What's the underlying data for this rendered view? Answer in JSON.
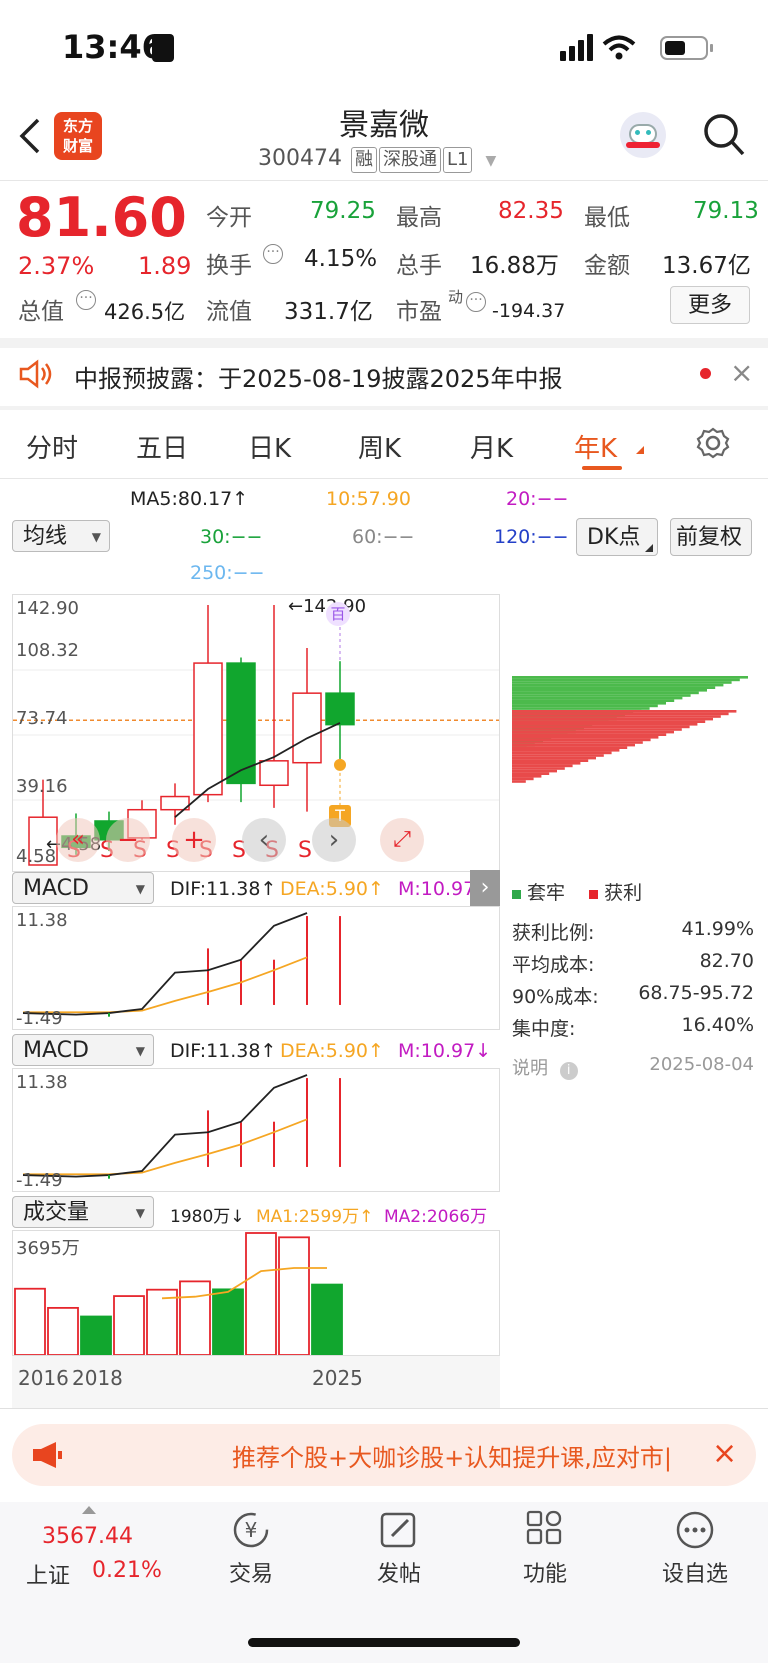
{
  "status": {
    "time": "13:46"
  },
  "header": {
    "back_icon": "chevron-left-icon",
    "logo_text_1": "东方",
    "logo_text_2": "财富",
    "title": "景嘉微",
    "code": "300474",
    "badges": [
      "融",
      "深股通",
      "L1"
    ],
    "avatar_icon": "robot-avatar-icon",
    "search_icon": "search-icon"
  },
  "quote": {
    "price": "81.60",
    "change_pct": "2.37%",
    "change_amt": "1.89",
    "open_label": "今开",
    "open": "79.25",
    "high_label": "最高",
    "high": "82.35",
    "low_label": "最低",
    "low": "79.13",
    "turnover_label": "换手",
    "turnover": "4.15%",
    "volume_label": "总手",
    "volume": "16.88万",
    "amount_label": "金额",
    "amount": "13.67亿",
    "total_mv_label": "总值",
    "total_mv": "426.5亿",
    "float_mv_label": "流值",
    "float_mv": "331.7亿",
    "pe_label": "市盈",
    "pe_sup": "动",
    "pe": "-194.37",
    "more_label": "更多"
  },
  "notice": {
    "text": "中报预披露：于2025-08-19披露2025年中报"
  },
  "tabs": {
    "items": [
      "分时",
      "五日",
      "日K",
      "周K",
      "月K",
      "年K"
    ],
    "active": "年K"
  },
  "ma_bar": {
    "ma5": "MA5:80.17↑",
    "time": "10:57.90",
    "ma20": "20:−−",
    "ma30": "30:−−",
    "ma60": "60:−−",
    "ma120": "120:−−",
    "ma250": "250:−−",
    "select_label": "均线",
    "dk_label": "DK点",
    "fq_label": "前复权"
  },
  "kline": {
    "y_labels": [
      "142.90",
      "108.32",
      "73.74",
      "39.16",
      "4.58"
    ],
    "max_marker": "←142.90",
    "min_marker": "←4.58",
    "s_marker": "S",
    "t_marker": "T",
    "baidu_marker": "百",
    "candles": [
      {
        "o": 4.58,
        "c": 30.0,
        "h": 50.0,
        "l": 4.58,
        "up": true
      },
      {
        "o": 14.0,
        "c": 20.0,
        "h": 32.0,
        "l": 10.0,
        "up": false
      },
      {
        "o": 28.0,
        "c": 18.0,
        "h": 33.0,
        "l": 12.0,
        "up": false
      },
      {
        "o": 19.0,
        "c": 34.0,
        "h": 39.0,
        "l": 18.0,
        "up": true
      },
      {
        "o": 34.0,
        "c": 41.0,
        "h": 48.0,
        "l": 26.0,
        "up": true
      },
      {
        "o": 42.0,
        "c": 112.0,
        "h": 142.9,
        "l": 38.0,
        "up": true
      },
      {
        "o": 112.0,
        "c": 48.0,
        "h": 115.0,
        "l": 38.0,
        "up": false
      },
      {
        "o": 47.0,
        "c": 60.0,
        "h": 142.9,
        "l": 35.0,
        "up": true
      },
      {
        "o": 59.0,
        "c": 96.0,
        "h": 120.0,
        "l": 33.0,
        "up": true
      },
      {
        "o": 96.0,
        "c": 79.25,
        "h": 113.0,
        "l": 60.0,
        "up": false
      }
    ],
    "ma5": [
      null,
      null,
      null,
      null,
      30.0,
      45.0,
      55.0,
      62.0,
      72.0,
      80.17
    ]
  },
  "macd1": {
    "select_label": "MACD",
    "dif": "DIF:11.38↑",
    "dea": "DEA:5.90↑",
    "m": "M:10.97↓",
    "y_top": "11.38",
    "y_bottom": "-1.49"
  },
  "macd2": {
    "select_label": "MACD",
    "dif": "DIF:11.38↑",
    "dea": "DEA:5.90↑",
    "m": "M:10.97↓",
    "y_top": "11.38",
    "y_bottom": "-1.49"
  },
  "macd_series": {
    "dif": [
      -1.0,
      -1.2,
      -1.0,
      -0.5,
      4.0,
      4.3,
      5.6,
      9.8,
      11.38
    ],
    "dea": [
      -0.9,
      -0.9,
      -0.9,
      -0.7,
      0.5,
      1.6,
      2.8,
      4.3,
      5.9
    ],
    "bars": [
      0,
      0,
      0,
      0,
      7.0,
      5.5,
      5.6,
      11.0,
      11.0
    ]
  },
  "volume": {
    "select_label": "成交量",
    "vol": "1980万↓",
    "ma1": "MA1:2599万↑",
    "ma2": "MA2:2066万",
    "y_top": "3695万",
    "x_labels": [
      "2016",
      "2018",
      "2025"
    ],
    "bars": [
      {
        "v": 1950,
        "up": true
      },
      {
        "v": 1350,
        "up": true
      },
      {
        "v": 1080,
        "up": false
      },
      {
        "v": 1720,
        "up": true
      },
      {
        "v": 1920,
        "up": true
      },
      {
        "v": 2180,
        "up": true
      },
      {
        "v": 1930,
        "up": false
      },
      {
        "v": 3695,
        "up": true
      },
      {
        "v": 3560,
        "up": true
      },
      {
        "v": 2080,
        "up": false
      }
    ],
    "ma": [
      null,
      null,
      null,
      null,
      1650,
      1700,
      1850,
      2500,
      2599,
      2599
    ]
  },
  "cost": {
    "legend_trapped": "套牢",
    "legend_profit": "获利",
    "rows": [
      {
        "label": "获利比例:",
        "value": "41.99%"
      },
      {
        "label": "平均成本:",
        "value": "82.70"
      },
      {
        "label": "90%成本:",
        "value": "68.75-95.72"
      },
      {
        "label": "集中度:",
        "value": "16.40%"
      }
    ],
    "note_label": "说明",
    "date": "2025-08-04"
  },
  "ad": {
    "text": "推荐个股+大咖诊股+认知提升课,应对市|"
  },
  "bottom_nav": {
    "index_value": "3567.44",
    "index_name": "上证",
    "index_change": "0.21%",
    "items": [
      {
        "label": "交易",
        "icon": "yen-exchange-icon"
      },
      {
        "label": "发帖",
        "icon": "edit-post-icon"
      },
      {
        "label": "功能",
        "icon": "grid-apps-icon"
      },
      {
        "label": "设自选",
        "icon": "more-dots-icon"
      }
    ]
  }
}
